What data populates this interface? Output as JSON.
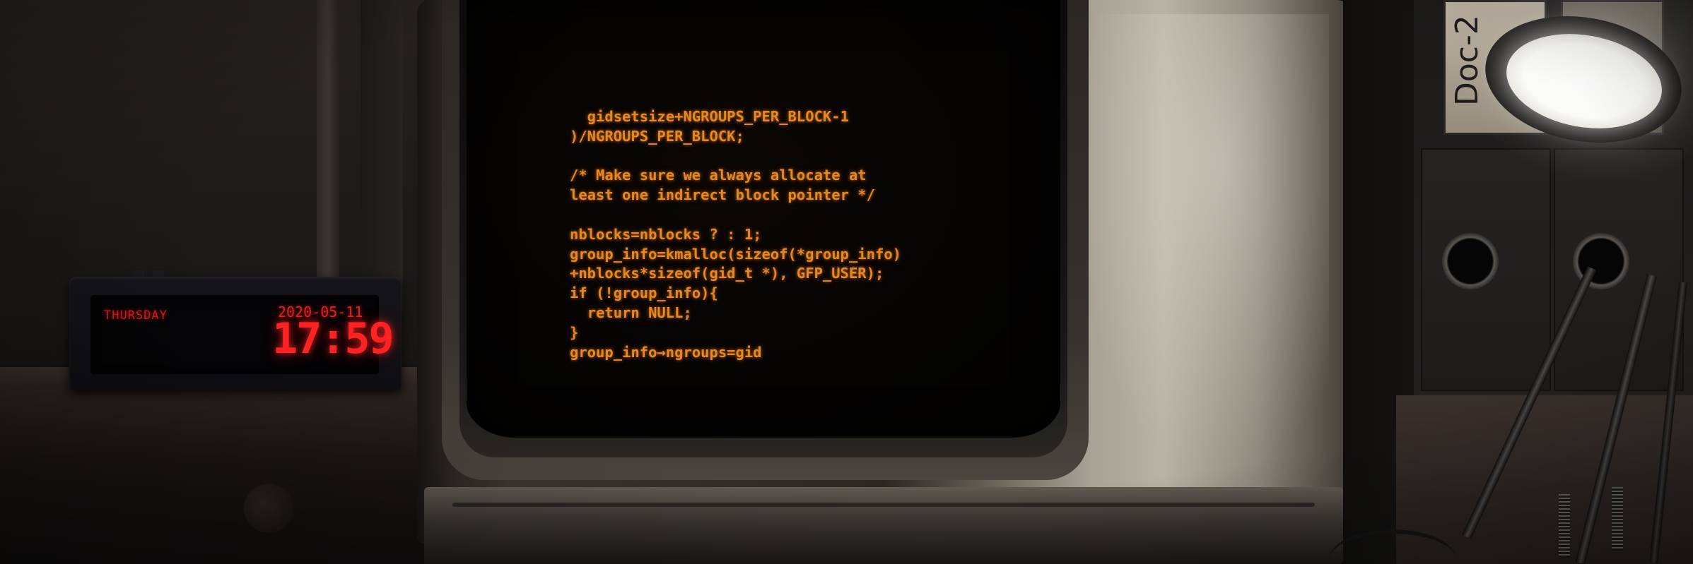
{
  "clock": {
    "day": "THURSDAY",
    "date": "2020-05-11",
    "time": "17:59",
    "digit_color": "#ff2222"
  },
  "monitor": {
    "text_color": "#e8891c",
    "code_lines": [
      "  gidsetsize+NGROUPS_PER_BLOCK-1",
      ")/NGROUPS_PER_BLOCK;",
      "",
      "/* Make sure we always allocate at",
      "least one indirect block pointer */",
      "",
      "nblocks=nblocks ? : 1;",
      "group_info=kmalloc(sizeof(*group_info)",
      "+nblocks*sizeof(gid_t *), GFP_USER);",
      "if (!group_info){",
      "  return NULL;",
      "}",
      "group_info→ngroups=gid"
    ]
  },
  "cabinet": {
    "label": "Doc-2"
  },
  "lamp": {
    "light_color": "#ffffff"
  }
}
